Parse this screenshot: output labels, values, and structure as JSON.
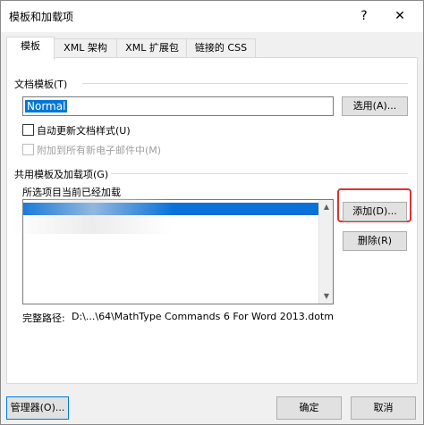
{
  "window": {
    "title": "模板和加载项",
    "help_button": "?",
    "close_button": "✕"
  },
  "tabs": [
    {
      "label": "模板"
    },
    {
      "label": "XML 架构"
    },
    {
      "label": "XML 扩展包"
    },
    {
      "label": "链接的 CSS"
    }
  ],
  "document_template": {
    "section_label": "文档模板(T)",
    "value": "Normal",
    "select_button": "选用(A)...",
    "auto_update_label": "自动更新文档样式(U)",
    "attach_email_label": "附加到所有新电子邮件中(M)"
  },
  "global_templates": {
    "section_label": "共用模板及加载项(G)",
    "list_label": "所选项目当前已经加载",
    "items": [
      ""
    ],
    "add_button": "添加(D)...",
    "remove_button": "删除(R)",
    "full_path_label": "完整路径:",
    "full_path_value": "D:\\...\\64\\MathType Commands 6 For Word 2013.dotm"
  },
  "footer": {
    "manager_button": "管理器(O)...",
    "ok_button": "确定",
    "cancel_button": "取消"
  },
  "colors": {
    "selection": "#0a71d9",
    "highlight_border": "#e0302f"
  }
}
